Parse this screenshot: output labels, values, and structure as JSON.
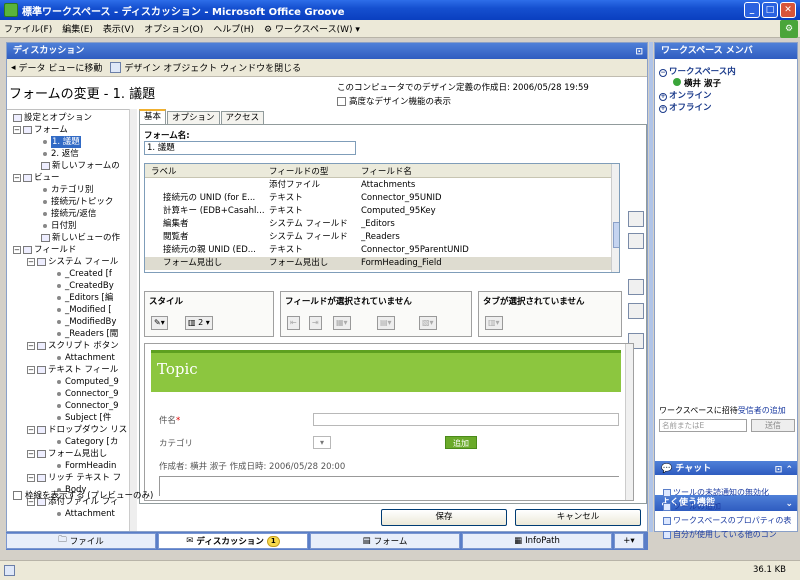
{
  "window": {
    "title": "標準ワークスペース - ディスカッション - Microsoft Office Groove"
  },
  "menu": {
    "file": "ファイル(F)",
    "edit": "編集(E)",
    "view": "表示(V)",
    "options": "オプション(O)",
    "help": "ヘルプ(H)",
    "workspace": "ワークスペース(W)"
  },
  "panel": {
    "title": "ディスカッション"
  },
  "toolbar": {
    "back": "データ ビューに移動",
    "close_design": "デザイン オブジェクト ウィンドウを閉じる"
  },
  "form": {
    "title": "フォームの変更 - 1. 議題",
    "design_date": "このコンピュータでのデザイン定義の作成日: 2006/05/28 19:59",
    "advanced": "高度なデザイン機能の表示"
  },
  "tree": [
    {
      "label": "設定とオプション"
    },
    {
      "label": "フォーム"
    },
    {
      "label": "1. 議題"
    },
    {
      "label": "2. 返信"
    },
    {
      "label": "新しいフォームの"
    },
    {
      "label": "ビュー"
    },
    {
      "label": "カテゴリ別"
    },
    {
      "label": "接続元/トピック"
    },
    {
      "label": "接続元/返信"
    },
    {
      "label": "日付別"
    },
    {
      "label": "新しいビューの作"
    },
    {
      "label": "フィールド"
    },
    {
      "label": "システム フィール"
    },
    {
      "label": "_Created [f"
    },
    {
      "label": "_CreatedBy"
    },
    {
      "label": "_Editors [編"
    },
    {
      "label": "_Modified ["
    },
    {
      "label": "_ModifiedBy"
    },
    {
      "label": "_Readers [閲"
    },
    {
      "label": "スクリプト ボタン"
    },
    {
      "label": "Attachment"
    },
    {
      "label": "テキスト フィール"
    },
    {
      "label": "Computed_9"
    },
    {
      "label": "Connector_9"
    },
    {
      "label": "Connector_9"
    },
    {
      "label": "Subject [件"
    },
    {
      "label": "ドロップダウン リス"
    },
    {
      "label": "Category [カ"
    },
    {
      "label": "フォーム見出し"
    },
    {
      "label": "FormHeadin"
    },
    {
      "label": "リッチ テキスト フ"
    },
    {
      "label": "Body"
    },
    {
      "label": "添付ファイル フィ"
    },
    {
      "label": "Attachment"
    }
  ],
  "tabs": {
    "basic": "基本",
    "options": "オプション",
    "access": "アクセス"
  },
  "formname": {
    "label": "フォーム名:",
    "value": "1. 議題"
  },
  "fieldtable": {
    "headers": [
      "ラベル",
      "フィールドの型",
      "フィールド名"
    ],
    "rows": [
      {
        "checked": true,
        "label": "",
        "type": "添付ファイル",
        "name": "Attachments"
      },
      {
        "checked": true,
        "label": "接続元の UNID (for E...",
        "type": "テキスト",
        "name": "Connector_95UNID"
      },
      {
        "checked": true,
        "label": "計算キー (EDB+Casahl...",
        "type": "テキスト",
        "name": "Computed_95Key"
      },
      {
        "checked": false,
        "label": "編集者",
        "type": "システム フィールド",
        "name": "_Editors"
      },
      {
        "checked": false,
        "label": "閲覧者",
        "type": "システム フィールド",
        "name": "_Readers"
      },
      {
        "checked": false,
        "label": "接続元の親 UNID (ED...",
        "type": "テキスト",
        "name": "Connector_95ParentUNID"
      },
      {
        "checked": true,
        "label": "フォーム見出し",
        "type": "フォーム見出し",
        "name": "FormHeading_Field"
      }
    ]
  },
  "groups": {
    "style": "スタイル",
    "field": "フィールドが選択されていません",
    "tab": "タブが選択されていません",
    "style_num": "2"
  },
  "preview": {
    "topic": "Topic",
    "subject": "件名",
    "required": "*",
    "category": "カテゴリ",
    "cat_button": "追加",
    "author": "作成者: 横井 淑子   作成日時: 2006/05/28 20:00"
  },
  "border_check": "枠線を表示する (プレビューのみ)",
  "buttons": {
    "save": "保存",
    "cancel": "キャンセル"
  },
  "bottomtabs": {
    "files": "ファイル",
    "discussion": "ディスカッション",
    "badge": "1",
    "forms": "フォーム",
    "infopath": "InfoPath"
  },
  "status": {
    "size": "36.1 KB"
  },
  "members": {
    "title": "ワークスペース メンバ",
    "in_ws": "ワークスペース内",
    "user": "横井 淑子",
    "online": "オンライン",
    "offline": "オフライン"
  },
  "invite": {
    "label": "ワークスペースに招待",
    "link": "受信者の追加",
    "placeholder": "名前またはE",
    "send": "送信"
  },
  "chat": {
    "title": "チャット"
  },
  "common": {
    "title": "よく使う機能",
    "items": [
      "ツールの未読通知の無効化",
      "ツールの追加",
      "ワークスペースのプロパティの表",
      "自分が使用している他のコン"
    ]
  },
  "colors": {
    "accent": "#2f5cc0",
    "preview_green": "#8cc63f"
  }
}
